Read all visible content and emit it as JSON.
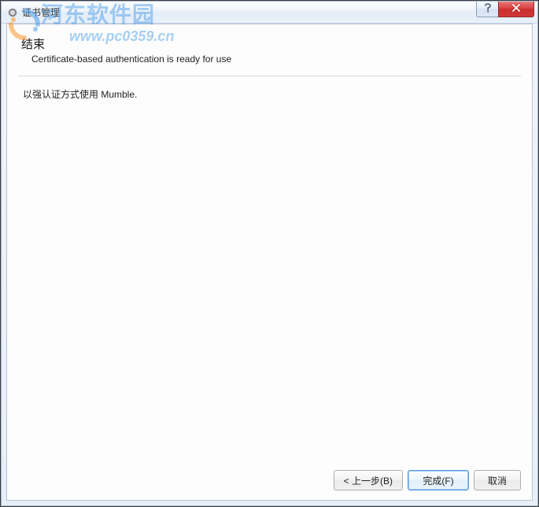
{
  "watermark": {
    "site_name": "河东软件园",
    "url_text": "www.pc0359.cn"
  },
  "window": {
    "title": "证书管理"
  },
  "wizard": {
    "header_title": "结束",
    "header_subtitle": "Certificate-based authentication is ready for use",
    "body_text": "以强认证方式使用 Mumble."
  },
  "buttons": {
    "back": "< 上一步(B)",
    "finish": "完成(F)",
    "cancel": "取消"
  }
}
